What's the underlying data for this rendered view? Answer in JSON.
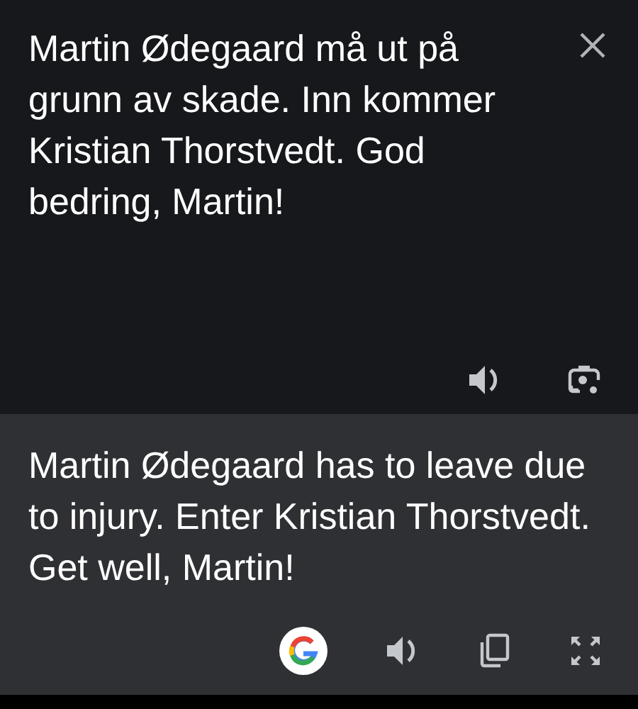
{
  "source": {
    "text": "Martin Ødegaard må ut på grunn av skade. Inn kommer Kristian Thorstvedt. God bedring, Martin!"
  },
  "translation": {
    "text": "Martin Ødegaard has to leave due to injury. Enter Kristian Thorstvedt. Get well, Martin!"
  }
}
